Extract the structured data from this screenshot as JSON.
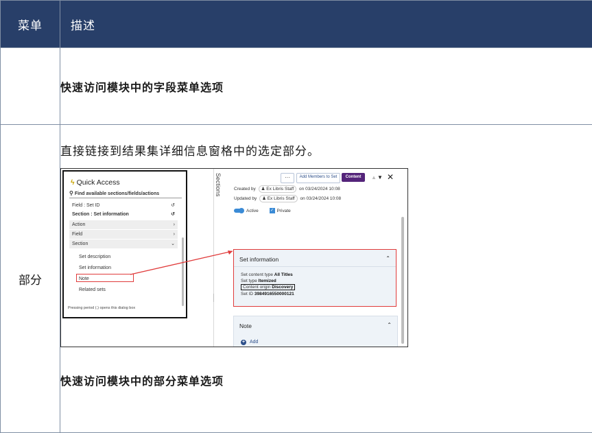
{
  "table": {
    "header": {
      "col1": "菜单",
      "col2": "描述"
    },
    "row1": {
      "menu": "",
      "text": "快速访问模块中的字段菜单选项"
    },
    "row2": {
      "menu": "部分",
      "description": "直接链接到结果集详细信息窗格中的选定部分。",
      "caption": "快速访问模块中的部分菜单选项"
    }
  },
  "screenshot": {
    "quick_access": {
      "title": "Quick Access",
      "search_placeholder": "Find available sections/fields/actions",
      "items": [
        {
          "label": "Field : Set ID",
          "icon": "history-icon"
        },
        {
          "label": "Section : Set information",
          "icon": "history-icon"
        },
        {
          "label": "Action",
          "icon": "chevron-right-icon"
        },
        {
          "label": "Field",
          "icon": "chevron-right-icon"
        },
        {
          "label": "Section",
          "icon": "chevron-down-icon"
        }
      ],
      "sub_items": [
        "Set description",
        "Set information",
        "Note",
        "Related sets"
      ],
      "footer": "Pressing period (.) opens this dialog box"
    },
    "sections_tab": "Sections",
    "toolbar": {
      "more": "···",
      "add_members": "Add Members to Set",
      "content": "Content"
    },
    "created": {
      "prefix": "Created by",
      "user": "Ex Libris Staff",
      "suffix": "on 03/24/2024 10:08"
    },
    "updated": {
      "prefix": "Updated by",
      "user": "Ex Libris Staff",
      "suffix": "on 03/24/2024 10:08"
    },
    "active_label": "Active",
    "private_label": "Private",
    "set_info": {
      "title": "Set information",
      "content_type_label": "Set content type",
      "content_type_value": "All Titles",
      "set_type_label": "Set type",
      "set_type_value": "Itemized",
      "origin_label": "Content origin",
      "origin_value": "Discovery",
      "set_id_label": "Set ID",
      "set_id_value": "3984916550000121"
    },
    "note": {
      "title": "Note",
      "add_label": "Add"
    },
    "colors": {
      "accent_red": "#e03a3a",
      "content_purple": "#54247a",
      "header_navy": "#283f69"
    }
  }
}
